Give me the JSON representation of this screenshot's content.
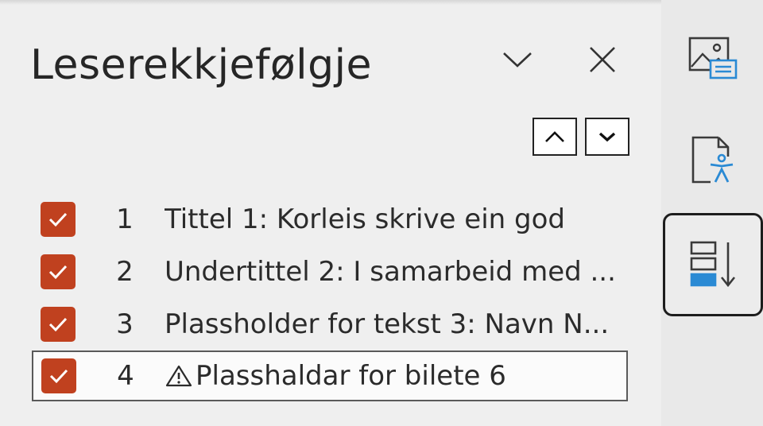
{
  "pane": {
    "title": "Leserekkjefølgje",
    "items": [
      {
        "number": "1",
        "label": "Tittel 1: Korleis skrive ein god",
        "checked": true,
        "warning": false
      },
      {
        "number": "2",
        "label": "Undertittel 2: I samarbeid med ...",
        "checked": true,
        "warning": false
      },
      {
        "number": "3",
        "label": "Plassholder for tekst 3: Navn N...",
        "checked": true,
        "warning": false
      },
      {
        "number": "4",
        "label": "Plasshaldar for bilete 6",
        "checked": true,
        "warning": true
      }
    ]
  },
  "icons": {
    "collapse": "chevron-down-icon",
    "close": "close-icon",
    "move_up": "arrow-up-icon",
    "move_down": "arrow-down-icon",
    "checkbox": "checkmark-icon",
    "warning": "warning-icon",
    "rail": [
      "alt-text-image-icon",
      "accessibility-document-icon",
      "reading-order-icon"
    ]
  },
  "colors": {
    "checkbox": "#c0411f",
    "accent_blue": "#2a8ad4",
    "pane_bg": "#efefef",
    "rail_bg": "#e9e9e9"
  }
}
